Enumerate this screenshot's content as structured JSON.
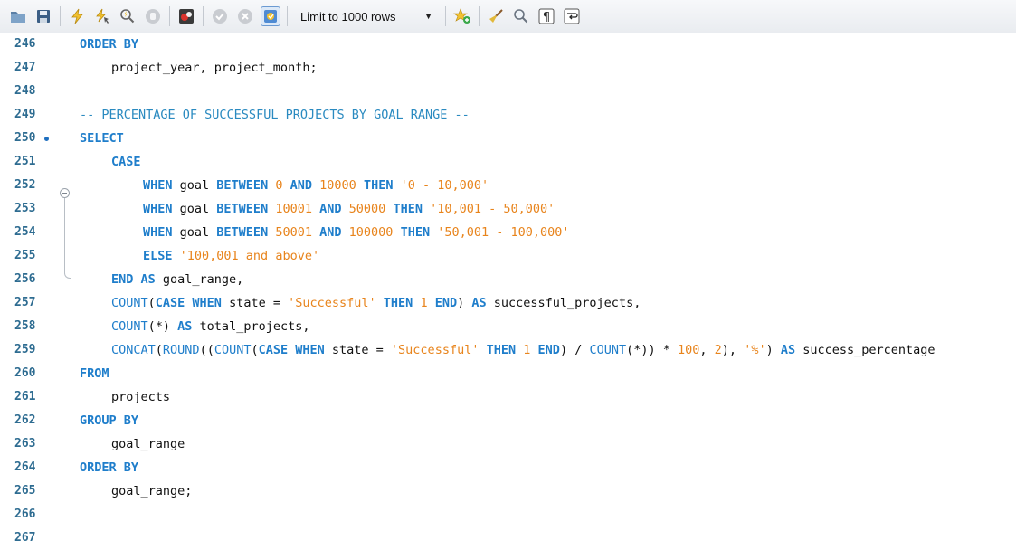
{
  "toolbar": {
    "buttons": [
      {
        "name": "open-file",
        "icon": "folder-icon"
      },
      {
        "name": "save",
        "icon": "floppy-disk-icon"
      },
      {
        "name": "execute",
        "icon": "lightning-bolt-icon"
      },
      {
        "name": "execute-current",
        "icon": "lightning-cursor-icon"
      },
      {
        "name": "explain",
        "icon": "magnifier-lightning-icon"
      },
      {
        "name": "stop",
        "icon": "stop-hand-icon"
      },
      {
        "name": "toggle-error",
        "icon": "stop-error-icon"
      },
      {
        "name": "commit",
        "icon": "check-circle-icon"
      },
      {
        "name": "rollback",
        "icon": "x-circle-icon"
      },
      {
        "name": "autocommit",
        "icon": "autocommit-icon"
      }
    ],
    "limit_label": "Limit to 1000 rows",
    "extra_buttons": [
      {
        "name": "add-snippet",
        "icon": "star-add-icon"
      },
      {
        "name": "beautify",
        "icon": "broom-icon"
      },
      {
        "name": "find",
        "icon": "magnifier-icon"
      },
      {
        "name": "invisible-chars",
        "icon": "pilcrow-icon"
      },
      {
        "name": "word-wrap",
        "icon": "wrap-icon"
      }
    ]
  },
  "editor": {
    "lines": [
      {
        "n": "246",
        "indent": 0,
        "tokens": [
          [
            "kw",
            "ORDER BY"
          ]
        ]
      },
      {
        "n": "247",
        "indent": 1,
        "tokens": [
          [
            "pl",
            "project_year, project_month;"
          ]
        ]
      },
      {
        "n": "248",
        "indent": 0,
        "tokens": []
      },
      {
        "n": "249",
        "indent": 0,
        "tokens": [
          [
            "cmt",
            "-- PERCENTAGE OF SUCCESSFUL PROJECTS BY GOAL RANGE --"
          ]
        ]
      },
      {
        "n": "250",
        "indent": 0,
        "breakpoint": true,
        "tokens": [
          [
            "kw",
            "SELECT"
          ]
        ]
      },
      {
        "n": "251",
        "indent": 1,
        "tokens": [
          [
            "kw",
            "CASE"
          ]
        ]
      },
      {
        "n": "252",
        "indent": 2,
        "tokens": [
          [
            "kw",
            "WHEN"
          ],
          [
            "pl",
            " goal "
          ],
          [
            "kw",
            "BETWEEN"
          ],
          [
            "pl",
            " "
          ],
          [
            "num",
            "0"
          ],
          [
            "pl",
            " "
          ],
          [
            "kw",
            "AND"
          ],
          [
            "pl",
            " "
          ],
          [
            "num",
            "10000"
          ],
          [
            "pl",
            " "
          ],
          [
            "kw",
            "THEN"
          ],
          [
            "pl",
            " "
          ],
          [
            "str",
            "'0 - 10,000'"
          ]
        ]
      },
      {
        "n": "253",
        "indent": 2,
        "tokens": [
          [
            "kw",
            "WHEN"
          ],
          [
            "pl",
            " goal "
          ],
          [
            "kw",
            "BETWEEN"
          ],
          [
            "pl",
            " "
          ],
          [
            "num",
            "10001"
          ],
          [
            "pl",
            " "
          ],
          [
            "kw",
            "AND"
          ],
          [
            "pl",
            " "
          ],
          [
            "num",
            "50000"
          ],
          [
            "pl",
            " "
          ],
          [
            "kw",
            "THEN"
          ],
          [
            "pl",
            " "
          ],
          [
            "str",
            "'10,001 - 50,000'"
          ]
        ]
      },
      {
        "n": "254",
        "indent": 2,
        "tokens": [
          [
            "kw",
            "WHEN"
          ],
          [
            "pl",
            " goal "
          ],
          [
            "kw",
            "BETWEEN"
          ],
          [
            "pl",
            " "
          ],
          [
            "num",
            "50001"
          ],
          [
            "pl",
            " "
          ],
          [
            "kw",
            "AND"
          ],
          [
            "pl",
            " "
          ],
          [
            "num",
            "100000"
          ],
          [
            "pl",
            " "
          ],
          [
            "kw",
            "THEN"
          ],
          [
            "pl",
            " "
          ],
          [
            "str",
            "'50,001 - 100,000'"
          ]
        ]
      },
      {
        "n": "255",
        "indent": 2,
        "tokens": [
          [
            "kw",
            "ELSE"
          ],
          [
            "pl",
            " "
          ],
          [
            "str",
            "'100,001 and above'"
          ]
        ]
      },
      {
        "n": "256",
        "indent": 1,
        "tokens": [
          [
            "kw",
            "END AS"
          ],
          [
            "pl",
            " goal_range,"
          ]
        ]
      },
      {
        "n": "257",
        "indent": 1,
        "tokens": [
          [
            "fn",
            "COUNT"
          ],
          [
            "pl",
            "("
          ],
          [
            "kw",
            "CASE WHEN"
          ],
          [
            "pl",
            " state = "
          ],
          [
            "str",
            "'Successful'"
          ],
          [
            "pl",
            " "
          ],
          [
            "kw",
            "THEN"
          ],
          [
            "pl",
            " "
          ],
          [
            "num",
            "1"
          ],
          [
            "pl",
            " "
          ],
          [
            "kw",
            "END"
          ],
          [
            "pl",
            ") "
          ],
          [
            "kw",
            "AS"
          ],
          [
            "pl",
            " successful_projects,"
          ]
        ]
      },
      {
        "n": "258",
        "indent": 1,
        "tokens": [
          [
            "fn",
            "COUNT"
          ],
          [
            "pl",
            "(*) "
          ],
          [
            "kw",
            "AS"
          ],
          [
            "pl",
            " total_projects,"
          ]
        ]
      },
      {
        "n": "259",
        "indent": 1,
        "tokens": [
          [
            "fn",
            "CONCAT"
          ],
          [
            "pl",
            "("
          ],
          [
            "fn",
            "ROUND"
          ],
          [
            "pl",
            "(("
          ],
          [
            "fn",
            "COUNT"
          ],
          [
            "pl",
            "("
          ],
          [
            "kw",
            "CASE WHEN"
          ],
          [
            "pl",
            " state = "
          ],
          [
            "str",
            "'Successful'"
          ],
          [
            "pl",
            " "
          ],
          [
            "kw",
            "THEN"
          ],
          [
            "pl",
            " "
          ],
          [
            "num",
            "1"
          ],
          [
            "pl",
            " "
          ],
          [
            "kw",
            "END"
          ],
          [
            "pl",
            ") / "
          ],
          [
            "fn",
            "COUNT"
          ],
          [
            "pl",
            "(*)) * "
          ],
          [
            "num",
            "100"
          ],
          [
            "pl",
            ", "
          ],
          [
            "num",
            "2"
          ],
          [
            "pl",
            "), "
          ],
          [
            "str",
            "'%'"
          ],
          [
            "pl",
            ") "
          ],
          [
            "kw",
            "AS"
          ],
          [
            "pl",
            " success_percentage"
          ]
        ]
      },
      {
        "n": "260",
        "indent": 0,
        "tokens": [
          [
            "kw",
            "FROM"
          ]
        ]
      },
      {
        "n": "261",
        "indent": 1,
        "tokens": [
          [
            "pl",
            "projects"
          ]
        ]
      },
      {
        "n": "262",
        "indent": 0,
        "tokens": [
          [
            "kw",
            "GROUP BY"
          ]
        ]
      },
      {
        "n": "263",
        "indent": 1,
        "tokens": [
          [
            "pl",
            "goal_range"
          ]
        ]
      },
      {
        "n": "264",
        "indent": 0,
        "tokens": [
          [
            "kw",
            "ORDER BY"
          ]
        ]
      },
      {
        "n": "265",
        "indent": 1,
        "tokens": [
          [
            "pl",
            "goal_range;"
          ]
        ]
      },
      {
        "n": "266",
        "indent": 0,
        "tokens": []
      },
      {
        "n": "267",
        "indent": 0,
        "tokens": []
      }
    ]
  }
}
